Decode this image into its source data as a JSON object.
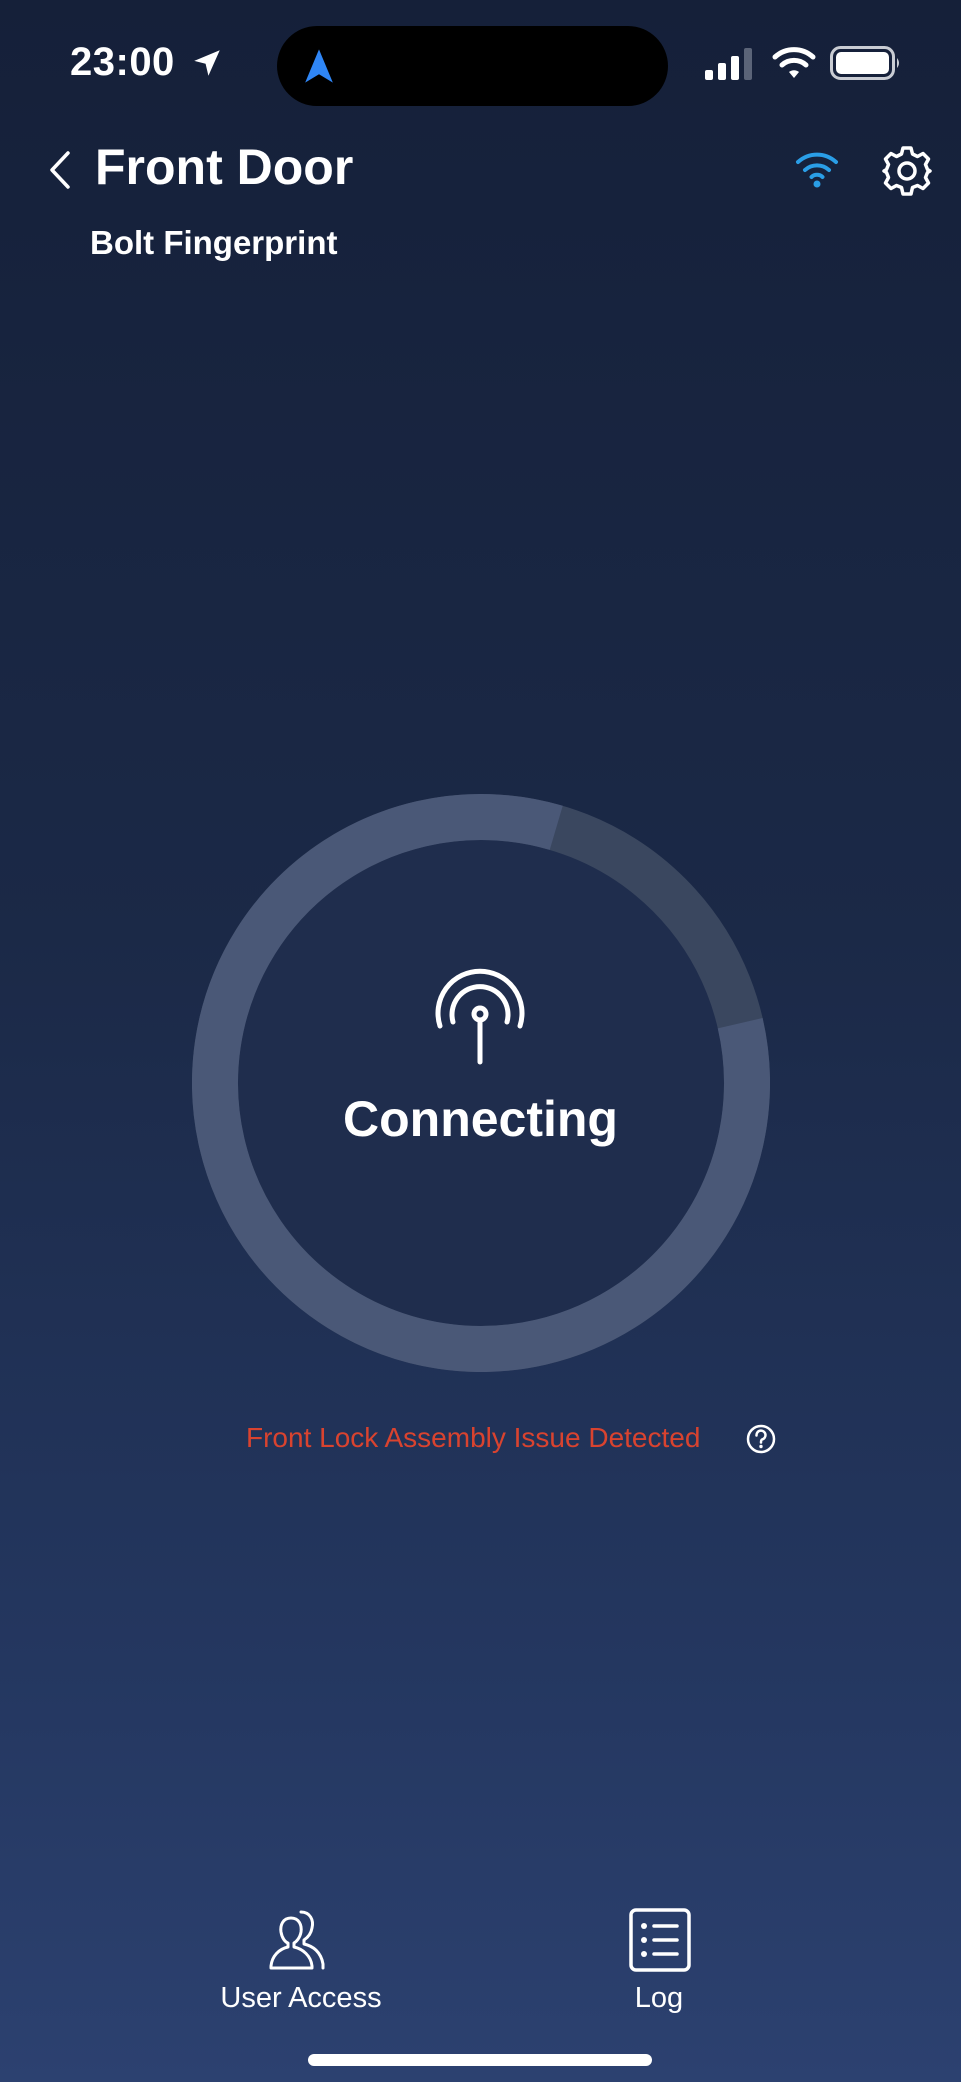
{
  "status_bar": {
    "time": "23:00"
  },
  "header": {
    "title": "Front Door",
    "subtitle": "Bolt Fingerprint"
  },
  "lock_status": {
    "label": "Connecting"
  },
  "alert": {
    "message": "Front Lock Assembly Issue Detected"
  },
  "bottom_nav": {
    "items": [
      {
        "label": "User Access",
        "icon": "users-icon"
      },
      {
        "label": "Log",
        "icon": "list-icon"
      }
    ]
  },
  "colors": {
    "background_top": "#152039",
    "background_bottom": "#2c4170",
    "alert": "#d9432f",
    "wifi_accent": "#2a9ee6",
    "nav_arrow": "#2f86f6"
  }
}
